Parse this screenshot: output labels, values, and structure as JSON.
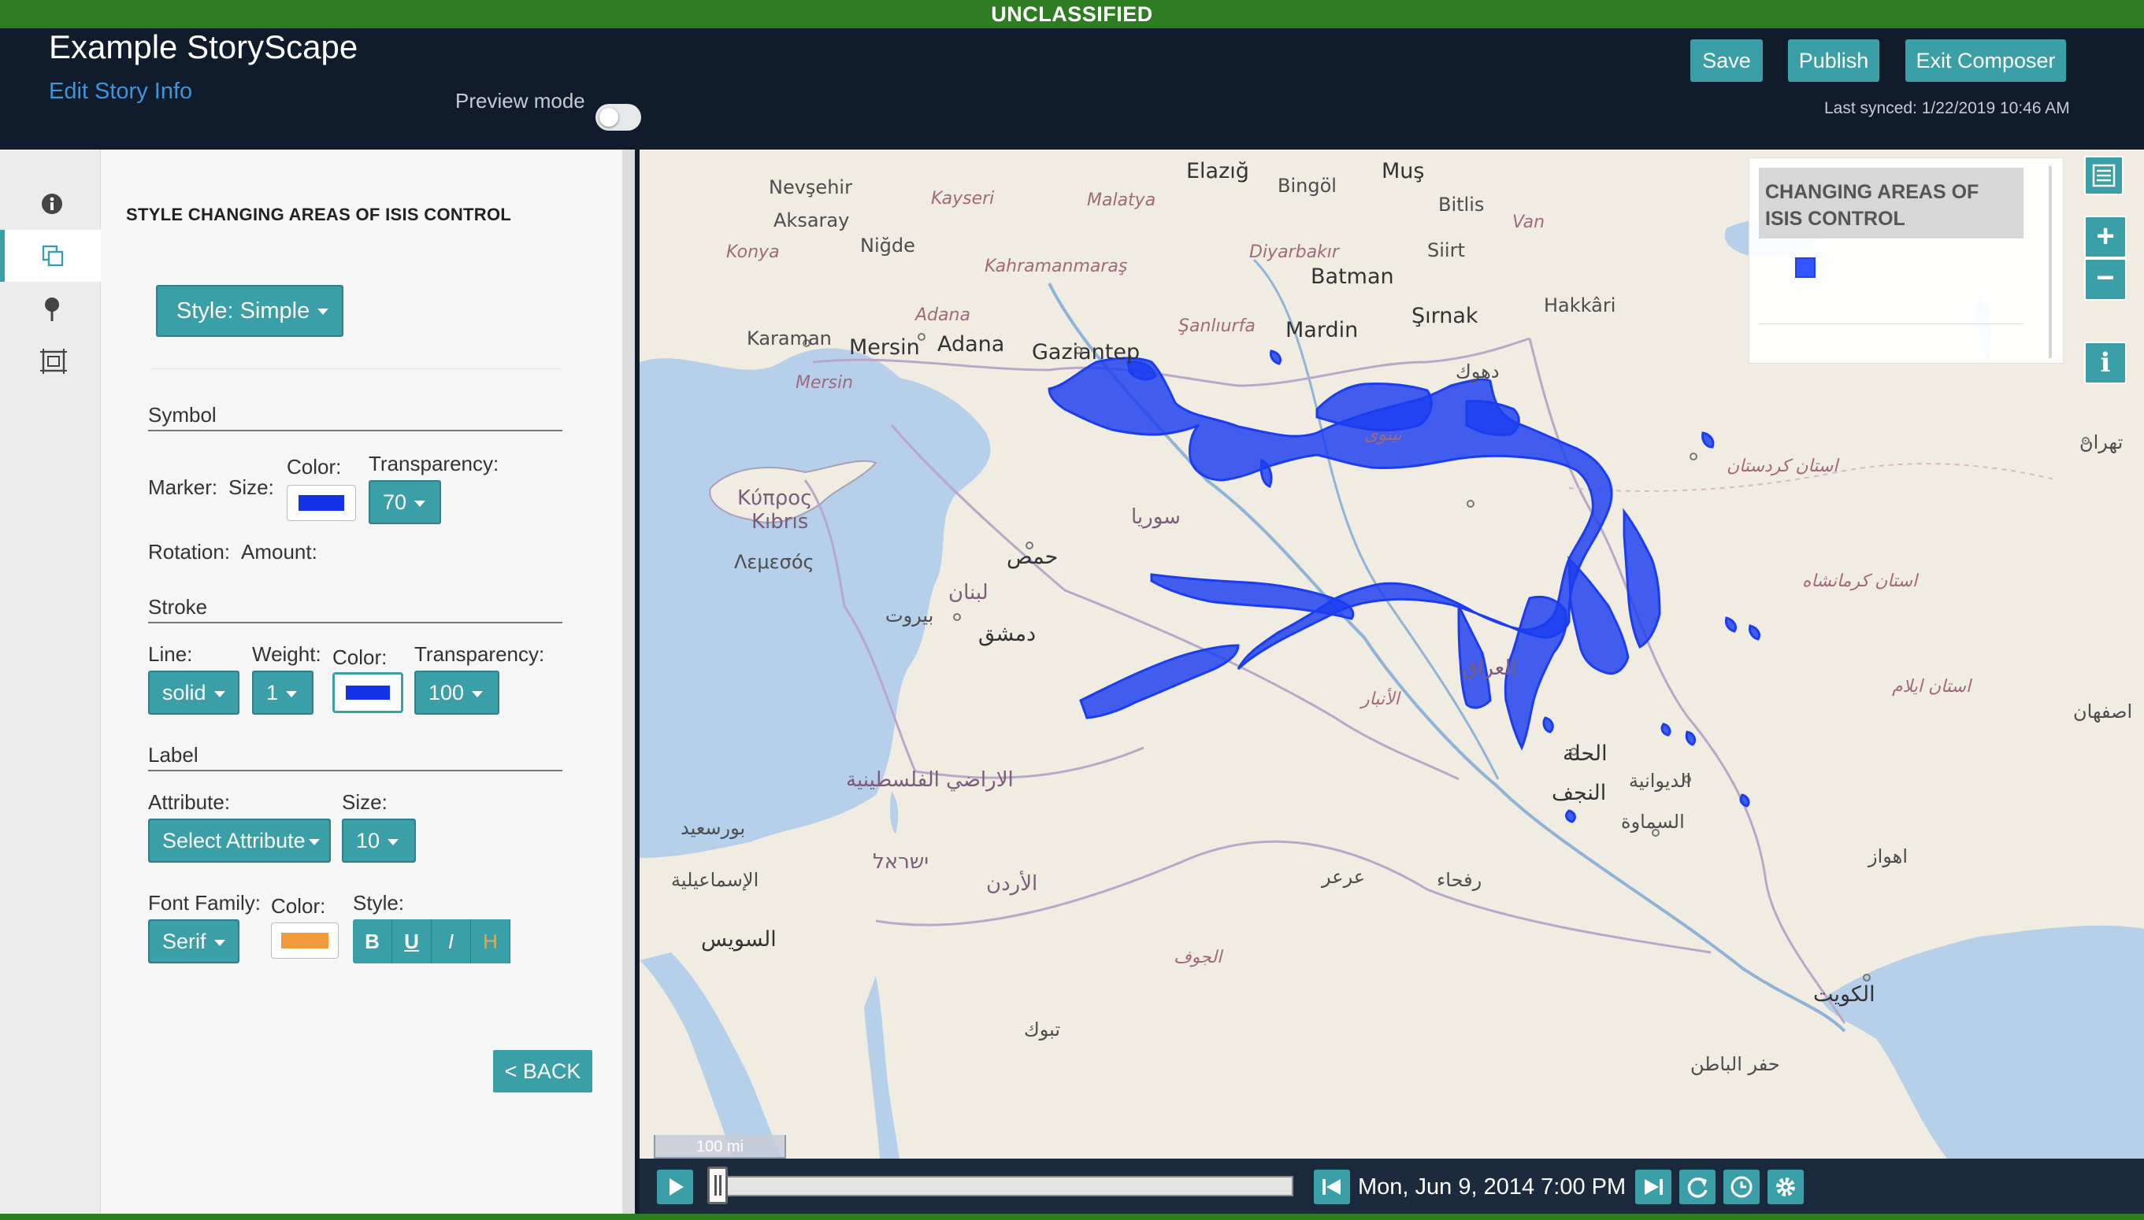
{
  "banner": "UNCLASSIFIED",
  "header": {
    "title": "Example StoryScape",
    "edit_link": "Edit Story Info",
    "preview_label": "Preview mode",
    "save": "Save",
    "publish": "Publish",
    "exit": "Exit Composer",
    "last_synced": "Last synced: 1/22/2019 10:46 AM"
  },
  "tabs": [
    {
      "icon": "info-icon"
    },
    {
      "icon": "layers-copy-icon",
      "active": true
    },
    {
      "icon": "map-pin-icon"
    },
    {
      "icon": "frame-icon"
    }
  ],
  "panel": {
    "title": "STYLE CHANGING AREAS OF ISIS CONTROL",
    "style_button": "Style: Simple",
    "symbol": {
      "heading": "Symbol",
      "marker": "Marker:",
      "size": "Size:",
      "color": "Color:",
      "transparency": "Transparency:",
      "transparency_value": "70",
      "rotation": "Rotation:",
      "amount": "Amount:",
      "color_value": "#1533e6"
    },
    "stroke": {
      "heading": "Stroke",
      "line": "Line:",
      "line_value": "solid",
      "weight": "Weight:",
      "weight_value": "1",
      "color": "Color:",
      "transparency": "Transparency:",
      "transparency_value": "100",
      "color_value": "#1533e6"
    },
    "label": {
      "heading": "Label",
      "attribute": "Attribute:",
      "attribute_value": "Select Attribute",
      "size": "Size:",
      "size_value": "10",
      "font_family": "Font Family:",
      "font_value": "Serif",
      "color": "Color:",
      "style": "Style:",
      "styles": [
        "B",
        "U",
        "I",
        "H"
      ],
      "color_value": "#f29b3a"
    },
    "back": "< BACK"
  },
  "legend": {
    "title": "CHANGING AREAS OF ISIS CONTROL",
    "swatch_color": "#3355ff"
  },
  "map_controls": {
    "zoom_in": "+",
    "zoom_out": "−",
    "info": "i",
    "scale": "100 mi"
  },
  "map_labels": [
    {
      "t": "Elazığ",
      "cls": "big"
    },
    {
      "t": "Bingöl"
    },
    {
      "t": "Muş",
      "cls": "big"
    },
    {
      "t": "Nevşehir"
    },
    {
      "t": "Kayseri",
      "cls": "region"
    },
    {
      "t": "Malatya",
      "cls": "region"
    },
    {
      "t": "Bitlis"
    },
    {
      "t": "Van",
      "cls": "region"
    },
    {
      "t": "Aksaray"
    },
    {
      "t": "Niğde"
    },
    {
      "t": "Kahramanmaraş",
      "cls": "region"
    },
    {
      "t": "Diyarbakır",
      "cls": "region"
    },
    {
      "t": "Siirt"
    },
    {
      "t": "Konya",
      "cls": "region"
    },
    {
      "t": "Batman",
      "cls": "big"
    },
    {
      "t": "Hakkâri"
    },
    {
      "t": "Şırnak",
      "cls": "big"
    },
    {
      "t": "Karaman"
    },
    {
      "t": "Adana",
      "cls": "region"
    },
    {
      "t": "Şanlıurfa",
      "cls": "region"
    },
    {
      "t": "Mardin",
      "cls": "big"
    },
    {
      "t": "Mersin",
      "cls": "big"
    },
    {
      "t": "Adana",
      "cls": "big"
    },
    {
      "t": "Gaziantep",
      "cls": "big"
    },
    {
      "t": "Mersin",
      "cls": "region"
    },
    {
      "t": "Κύπρος",
      "cls": "country"
    },
    {
      "t": "Kıbrıs",
      "cls": "country"
    },
    {
      "t": "Λεμεσός"
    },
    {
      "t": "سوريا",
      "cls": "country"
    },
    {
      "t": "حمص",
      "cls": "big"
    },
    {
      "t": "لبنان",
      "cls": "country"
    },
    {
      "t": "بيروت"
    },
    {
      "t": "دمشق",
      "cls": "big"
    },
    {
      "t": "ישראל",
      "cls": "country"
    },
    {
      "t": "الأردن",
      "cls": "country"
    },
    {
      "t": "العراق",
      "cls": "country"
    },
    {
      "t": "الحلة",
      "cls": "big"
    },
    {
      "t": "النجف",
      "cls": "big"
    },
    {
      "t": "الديوانية"
    },
    {
      "t": "السماوة"
    },
    {
      "t": "الكويت",
      "cls": "big"
    },
    {
      "t": "اصفهان"
    },
    {
      "t": "تهران"
    },
    {
      "t": "اهواز"
    },
    {
      "t": "الإسماعيلية"
    },
    {
      "t": "السويس",
      "cls": "big"
    },
    {
      "t": "بورسعيد"
    },
    {
      "t": "الاراضي الفلسطينية",
      "cls": "country"
    },
    {
      "t": "تبوك"
    },
    {
      "t": "الجوف",
      "cls": "region"
    },
    {
      "t": "الأنبار",
      "cls": "region"
    },
    {
      "t": "عرعر"
    },
    {
      "t": "رفحاء"
    },
    {
      "t": "حفر الباطن"
    },
    {
      "t": "استان ایلام",
      "cls": "region"
    },
    {
      "t": "استان کرمانشاه",
      "cls": "region"
    },
    {
      "t": "استان کردستان",
      "cls": "region"
    },
    {
      "t": "دهوك"
    },
    {
      "t": "نينوى",
      "cls": "region"
    }
  ],
  "playback": {
    "datetime": "Mon, Jun 9, 2014 7:00 PM"
  }
}
